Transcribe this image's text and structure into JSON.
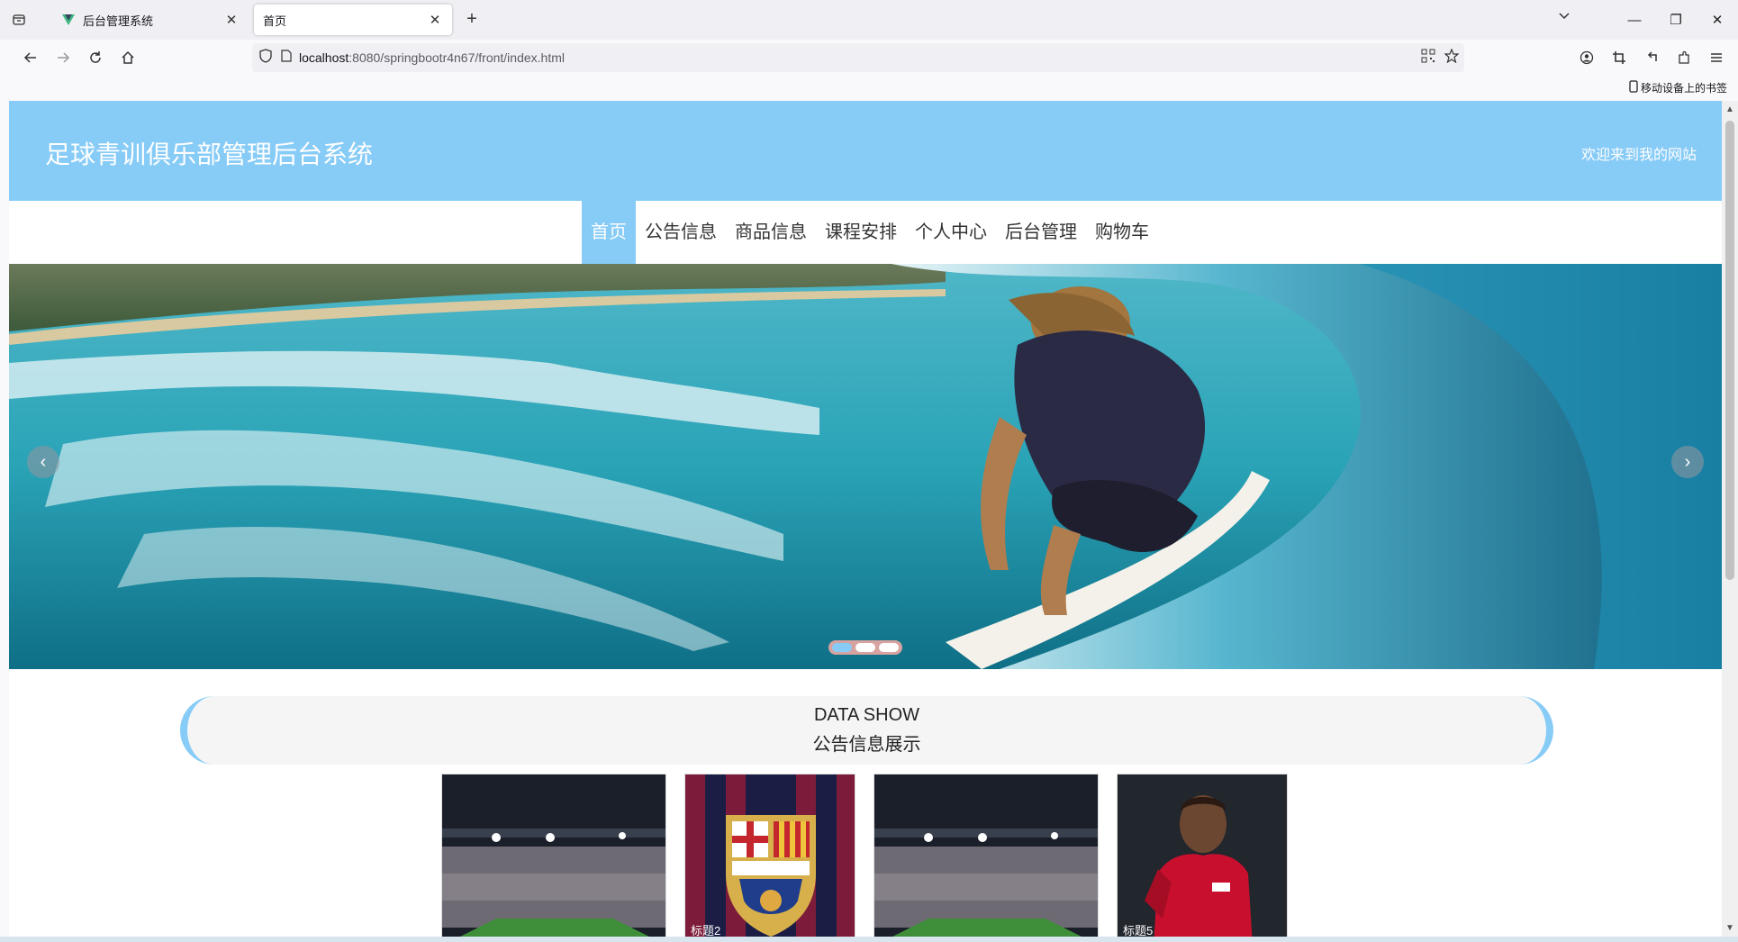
{
  "browser": {
    "tabs": [
      {
        "title": "后台管理系统",
        "active": false,
        "favicon": "vue-logo-icon"
      },
      {
        "title": "首页",
        "active": true,
        "favicon": "none"
      }
    ],
    "url_host": "localhost",
    "url_path": ":8080/springbootr4n67/front/index.html",
    "bookmarks_mobile": "移动设备上的书签"
  },
  "site": {
    "title": "足球青训俱乐部管理后台系统",
    "welcome": "欢迎来到我的网站",
    "accent": "#87cbf7",
    "nav": [
      "首页",
      "公告信息",
      "商品信息",
      "课程安排",
      "个人中心",
      "后台管理",
      "购物车"
    ],
    "nav_active_index": 0
  },
  "carousel": {
    "slide_count": 3,
    "active_index": 0
  },
  "section": {
    "title_en": "DATA SHOW",
    "title_cn": "公告信息展示"
  },
  "cards": [
    {
      "image": "stadium",
      "caption": ""
    },
    {
      "image": "fcb-crest",
      "caption": "标题2"
    },
    {
      "image": "stadium",
      "caption": ""
    },
    {
      "image": "player",
      "caption": "标题5"
    }
  ]
}
